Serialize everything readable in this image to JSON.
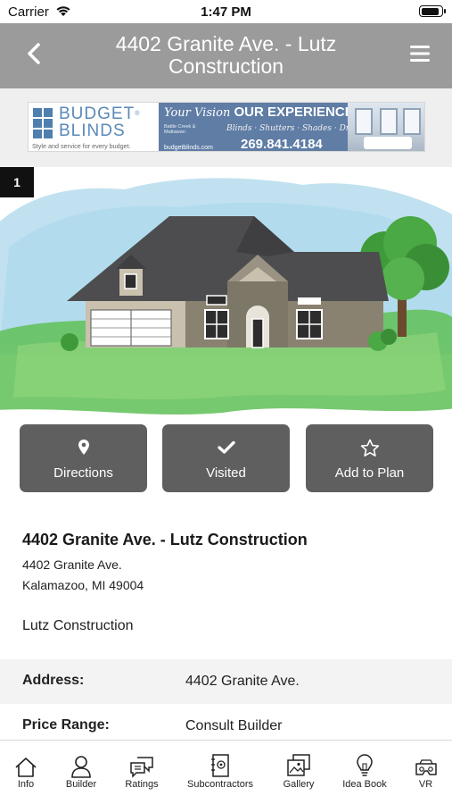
{
  "status_bar": {
    "carrier": "Carrier",
    "time": "1:47 PM",
    "battery_level": 0.95
  },
  "header": {
    "title": "4402 Granite Ave. - Lutz Construction",
    "back_icon": "chevron-left-icon",
    "menu_icon": "hamburger-menu-icon"
  },
  "ad": {
    "brand": "BUDGET BLINDS",
    "brand_line1": "BUDGET",
    "brand_line2": "BLINDS",
    "tagline": "Style and service for every budget.",
    "vision_script": "Your Vision",
    "vision_bold": "OUR EXPERIENCE.",
    "location": "Battle Creek & Mattawan",
    "services": "Blinds · Shutters · Shades · Drapes",
    "url": "budgetblinds.com",
    "phone": "269.841.4184"
  },
  "hero": {
    "index": "1"
  },
  "actions": [
    {
      "label": "Directions",
      "icon": "map-pin-icon"
    },
    {
      "label": "Visited",
      "icon": "checkmark-icon"
    },
    {
      "label": "Add to Plan",
      "icon": "star-icon"
    }
  ],
  "info": {
    "title": "4402 Granite Ave. - Lutz Construction",
    "street": "4402 Granite Ave.",
    "city": "Kalamazoo, MI 49004",
    "builder": "Lutz Construction"
  },
  "details": [
    {
      "label": "Address:",
      "value": "4402 Granite Ave."
    },
    {
      "label": "Price Range:",
      "value": "Consult Builder"
    }
  ],
  "tabs": [
    {
      "label": "Info",
      "icon": "house-icon"
    },
    {
      "label": "Builder",
      "icon": "person-icon"
    },
    {
      "label": "Ratings",
      "icon": "chat-bubbles-icon"
    },
    {
      "label": "Subcontractors",
      "icon": "contact-book-icon"
    },
    {
      "label": "Gallery",
      "icon": "photo-gallery-icon"
    },
    {
      "label": "Idea Book",
      "icon": "lightbulb-icon"
    },
    {
      "label": "VR",
      "icon": "vr-headset-icon"
    }
  ],
  "colors": {
    "header_bg": "#9b9b9b",
    "button_bg": "#5f5f5f",
    "ad_bg": "#5f7da5",
    "brand_blue": "#5a89b8"
  }
}
